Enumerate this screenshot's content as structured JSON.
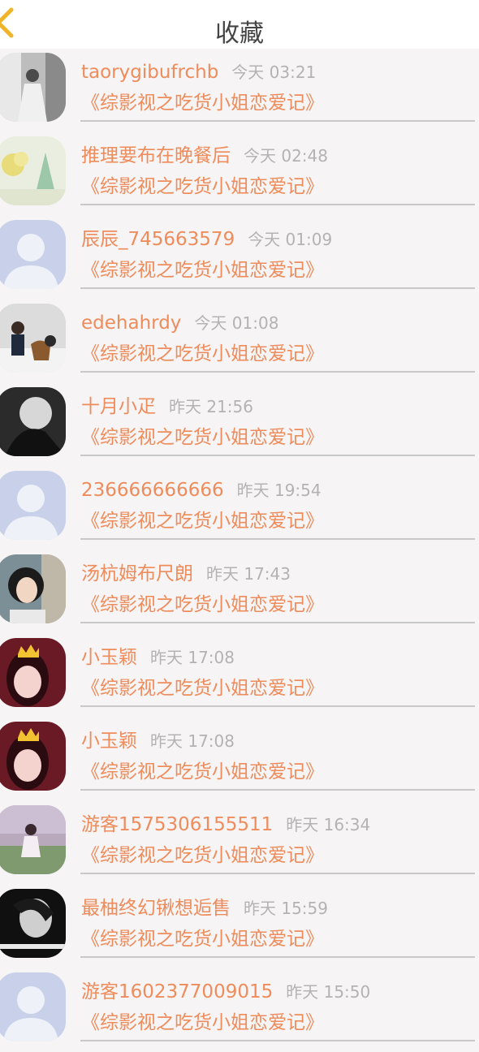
{
  "header": {
    "title": "收藏",
    "back_icon": "chevron-left-icon",
    "accent": "#f0b429"
  },
  "favorites": [
    {
      "name": "taorygibufrchb",
      "time": "今天 03:21",
      "book": "《综影视之吃货小姐恋爱记》",
      "avatar": "photo"
    },
    {
      "name": "推理要布在晚餐后",
      "time": "今天 02:48",
      "book": "《综影视之吃货小姐恋爱记》",
      "avatar": "photo"
    },
    {
      "name": "辰辰_745663579",
      "time": "今天 01:09",
      "book": "《综影视之吃货小姐恋爱记》",
      "avatar": "default-user-icon"
    },
    {
      "name": "edehahrdy",
      "time": "今天 01:08",
      "book": "《综影视之吃货小姐恋爱记》",
      "avatar": "photo"
    },
    {
      "name": "十月小疋",
      "time": "昨天 21:56",
      "book": "《综影视之吃货小姐恋爱记》",
      "avatar": "photo"
    },
    {
      "name": "236666666666",
      "time": "昨天 19:54",
      "book": "《综影视之吃货小姐恋爱记》",
      "avatar": "default-user-icon"
    },
    {
      "name": "汤杭姆布尺朗",
      "time": "昨天 17:43",
      "book": "《综影视之吃货小姐恋爱记》",
      "avatar": "photo"
    },
    {
      "name": "小玉颖",
      "time": "昨天 17:08",
      "book": "《综影视之吃货小姐恋爱记》",
      "avatar": "photo"
    },
    {
      "name": "小玉颖",
      "time": "昨天 17:08",
      "book": "《综影视之吃货小姐恋爱记》",
      "avatar": "photo"
    },
    {
      "name": "游客1575306155511",
      "time": "昨天 16:34",
      "book": "《综影视之吃货小姐恋爱记》",
      "avatar": "photo"
    },
    {
      "name": "最柚终幻锹想逅售",
      "time": "昨天 15:59",
      "book": "《综影视之吃货小姐恋爱记》",
      "avatar": "photo"
    },
    {
      "name": "游客1602377009015",
      "time": "昨天 15:50",
      "book": "《综影视之吃货小姐恋爱记》",
      "avatar": "default-user-icon"
    }
  ],
  "colors": {
    "name": "#ee8c5c",
    "time": "#b3b3b3",
    "background": "#f6f4f5",
    "default_avatar_bg": "#c9d1ea"
  }
}
